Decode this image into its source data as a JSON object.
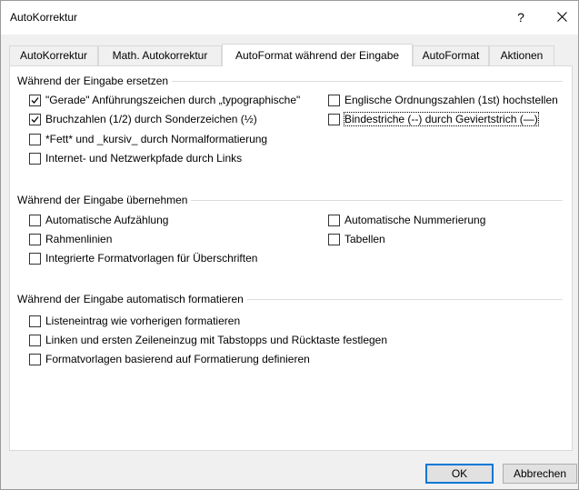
{
  "window": {
    "title": "AutoKorrektur",
    "help_glyph": "?",
    "close_icon": "close-icon"
  },
  "tabs": [
    {
      "label": "AutoKorrektur",
      "active": false
    },
    {
      "label": "Math. Autokorrektur",
      "active": false
    },
    {
      "label": "AutoFormat während der Eingabe",
      "active": true
    },
    {
      "label": "AutoFormat",
      "active": false
    },
    {
      "label": "Aktionen",
      "active": false
    }
  ],
  "sections": {
    "replace": {
      "title": "Während der Eingabe ersetzen",
      "options": [
        {
          "label": "\"Gerade\" Anführungszeichen durch „typographische\"",
          "checked": true
        },
        {
          "label": "Englische Ordnungszahlen (1st) hochstellen",
          "checked": false
        },
        {
          "label": "Bruchzahlen (1/2) durch Sonderzeichen (½)",
          "checked": true
        },
        {
          "label": "Bindestriche (--) durch Geviertstrich (—)",
          "checked": false
        },
        {
          "label": "*Fett* und _kursiv_ durch Normalformatierung",
          "checked": false
        },
        {
          "label": "Internet- und Netzwerkpfade durch Links",
          "checked": false
        }
      ]
    },
    "apply": {
      "title": "Während der Eingabe übernehmen",
      "options": [
        {
          "label": "Automatische Aufzählung",
          "checked": false
        },
        {
          "label": "Automatische Nummerierung",
          "checked": false
        },
        {
          "label": "Rahmenlinien",
          "checked": false
        },
        {
          "label": "Tabellen",
          "checked": false
        },
        {
          "label": "Integrierte Formatvorlagen für Überschriften",
          "checked": false
        }
      ]
    },
    "auto_format": {
      "title": "Während der Eingabe automatisch formatieren",
      "options": [
        {
          "label": "Listeneintrag wie vorherigen formatieren",
          "checked": false
        },
        {
          "label": "Linken und ersten Zeileneinzug mit Tabstopps und Rücktaste festlegen",
          "checked": false
        },
        {
          "label": "Formatvorlagen basierend auf Formatierung definieren",
          "checked": false
        }
      ]
    }
  },
  "buttons": {
    "ok": "OK",
    "cancel": "Abbrechen"
  },
  "colors": {
    "default_button_border": "#0078d7"
  }
}
